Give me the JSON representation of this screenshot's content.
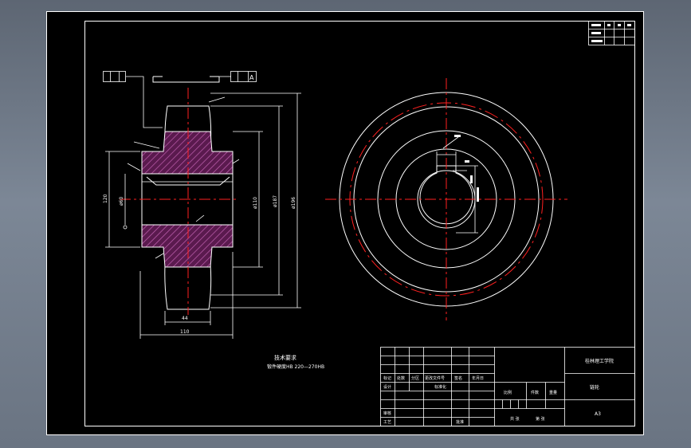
{
  "colors": {
    "background_outer": "#6f7a88",
    "sheet": "#000000",
    "line": "#ffffff",
    "centerline": "#ff2020",
    "hatch_fill": "#5a1a4e",
    "hatch_line": "#b04a9a"
  },
  "datum_label": "A",
  "dims": {
    "hub_width": "110",
    "left_dia": "120",
    "bore": "ø60",
    "hub_dia": "ø110",
    "root_dia": "ø187",
    "outer_dia": "ø196",
    "face_width": "44"
  },
  "notes": {
    "title": "技术要求",
    "line1": "锻件硬度HB 220—270HB"
  },
  "title_block": {
    "school": "桂林理工学院",
    "part_name": "链轮",
    "scale_label": "比例",
    "qty_label": "件数",
    "weight_label": "重量",
    "sheet_label": "共 张",
    "sheet_num": "第 张",
    "drawing_no": "A3",
    "rows": {
      "mark": "标记",
      "count": "处数",
      "zone": "分区",
      "doc": "更改文件号",
      "sign": "签名",
      "date": "年月日",
      "design": "设计",
      "std": "标准化",
      "review": "审核",
      "process": "工艺",
      "approve": "批准"
    }
  }
}
